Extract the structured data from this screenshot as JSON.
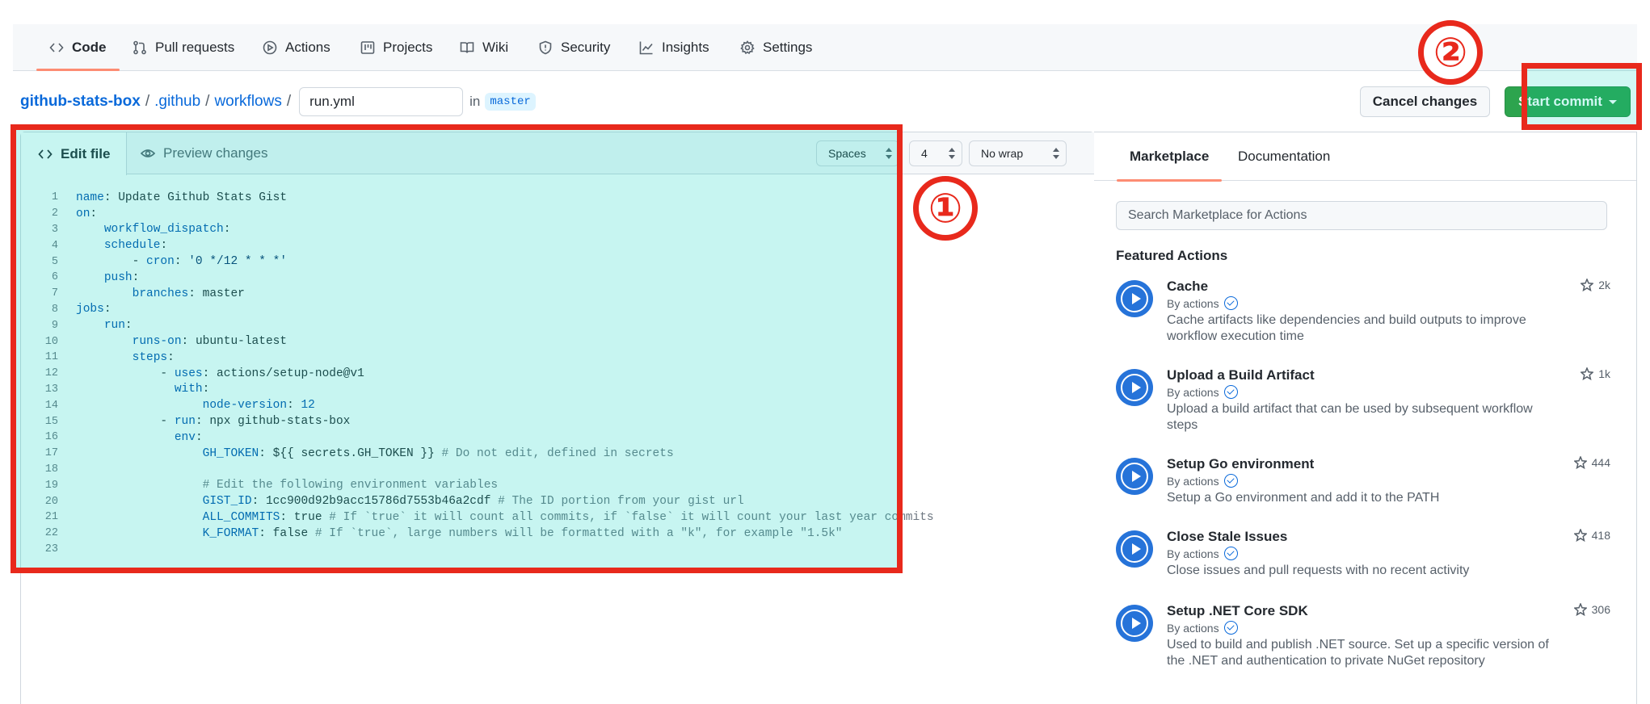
{
  "repo_nav": {
    "tabs": [
      {
        "label": "Code",
        "icon": "code-icon",
        "active": true
      },
      {
        "label": "Pull requests",
        "icon": "pull-request-icon"
      },
      {
        "label": "Actions",
        "icon": "play-circle-icon"
      },
      {
        "label": "Projects",
        "icon": "project-board-icon"
      },
      {
        "label": "Wiki",
        "icon": "book-icon"
      },
      {
        "label": "Security",
        "icon": "shield-icon"
      },
      {
        "label": "Insights",
        "icon": "graph-icon"
      },
      {
        "label": "Settings",
        "icon": "gear-icon"
      }
    ]
  },
  "breadcrumb": {
    "repo": "github-stats-box",
    "sep1": "/",
    "dir1": ".github",
    "sep2": "/",
    "dir2": "workflows",
    "sep3": "/",
    "filename": "run.yml",
    "in_word": "in",
    "branch": "master"
  },
  "actions": {
    "cancel_label": "Cancel changes",
    "commit_label": "Start commit"
  },
  "editor": {
    "tab_edit": "Edit file",
    "tab_preview": "Preview changes",
    "indent_mode": "Spaces",
    "indent_size": "4",
    "wrap_mode": "No wrap",
    "lines": [
      "name: Update Github Stats Gist",
      "on:",
      "    workflow_dispatch:",
      "    schedule:",
      "        - cron: '0 */12 * * *'",
      "    push:",
      "        branches: master",
      "jobs:",
      "    run:",
      "        runs-on: ubuntu-latest",
      "        steps:",
      "            - uses: actions/setup-node@v1",
      "              with:",
      "                  node-version: 12",
      "            - run: npx github-stats-box",
      "              env:",
      "                  GH_TOKEN: ${{ secrets.GH_TOKEN }} # Do not edit, defined in secrets",
      "",
      "                  # Edit the following environment variables",
      "                  GIST_ID: 1cc900d92b9acc15786d7553b46a2cdf # The ID portion from your gist url",
      "                  ALL_COMMITS: true # If `true` it will count all commits, if `false` it will count your last year commits",
      "                  K_FORMAT: false # If `true`, large numbers will be formatted with a \"k\", for example \"1.5k\"",
      ""
    ]
  },
  "annotations": {
    "badge1": "①",
    "badge2": "②",
    "highlight_color": "#e8291c"
  },
  "sidebar": {
    "tab_marketplace": "Marketplace",
    "tab_documentation": "Documentation",
    "search_placeholder": "Search Marketplace for Actions",
    "featured_heading": "Featured Actions",
    "items": [
      {
        "title": "Cache",
        "by": "By actions",
        "desc": "Cache artifacts like dependencies and build outputs to improve workflow execution time",
        "stars": "2k"
      },
      {
        "title": "Upload a Build Artifact",
        "by": "By actions",
        "desc": "Upload a build artifact that can be used by subsequent workflow steps",
        "stars": "1k"
      },
      {
        "title": "Setup Go environment",
        "by": "By actions",
        "desc": "Setup a Go environment and add it to the PATH",
        "stars": "444"
      },
      {
        "title": "Close Stale Issues",
        "by": "By actions",
        "desc": "Close issues and pull requests with no recent activity",
        "stars": "418"
      },
      {
        "title": "Setup .NET Core SDK",
        "by": "By actions",
        "desc": "Used to build and publish .NET source. Set up a specific version of the .NET and authentication to private NuGet repository",
        "stars": "306"
      }
    ]
  }
}
